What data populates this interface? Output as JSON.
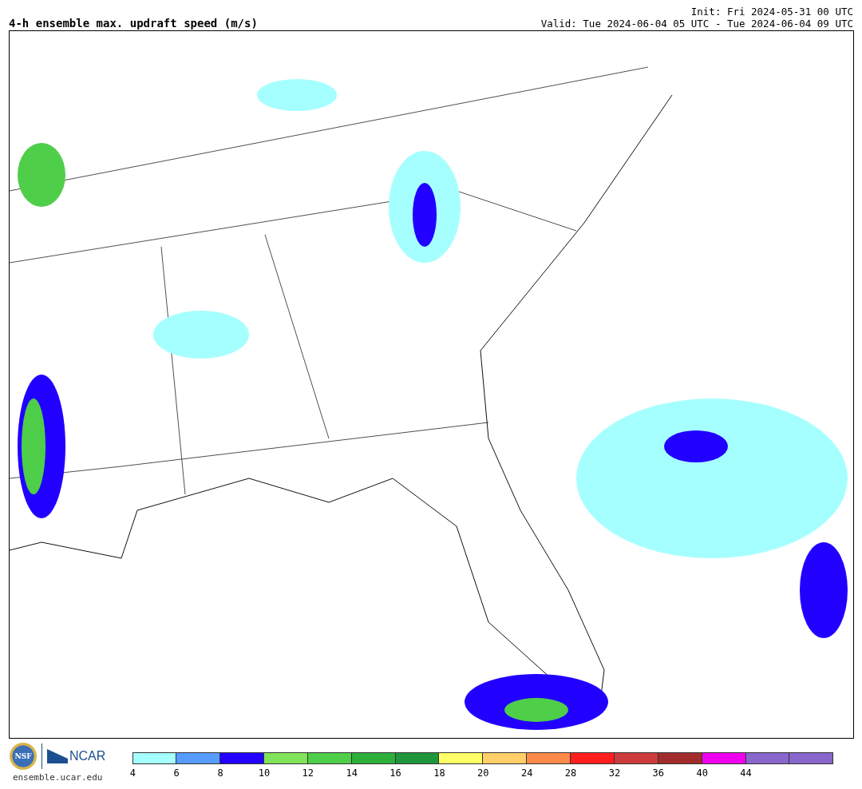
{
  "title": "4-h ensemble max. updraft speed (m/s)",
  "init": "Init: Fri 2024-05-31 00 UTC",
  "valid": "Valid: Tue 2024-06-04 05 UTC - Tue 2024-06-04 09 UTC",
  "logos": {
    "nsf": "NSF",
    "ncar": "NCAR",
    "url": "ensemble.ucar.edu"
  },
  "legend": [
    {
      "color": "#a6ffff",
      "label": "4"
    },
    {
      "color": "#569bff",
      "label": "6"
    },
    {
      "color": "#2200ff",
      "label": "8"
    },
    {
      "color": "#80e35a",
      "label": "10"
    },
    {
      "color": "#4fce4a",
      "label": "12"
    },
    {
      "color": "#2db03a",
      "label": "14"
    },
    {
      "color": "#1f963b",
      "label": "16"
    },
    {
      "color": "#ffff66",
      "label": "18"
    },
    {
      "color": "#ffcf6a",
      "label": "20"
    },
    {
      "color": "#ff8a4a",
      "label": "24"
    },
    {
      "color": "#ff1e1e",
      "label": "28"
    },
    {
      "color": "#cc3c3c",
      "label": "32"
    },
    {
      "color": "#a22c2c",
      "label": "36"
    },
    {
      "color": "#ee00ee",
      "label": "40"
    },
    {
      "color": "#8866cc",
      "label": "44"
    },
    {
      "color": "#8866cc"
    }
  ]
}
